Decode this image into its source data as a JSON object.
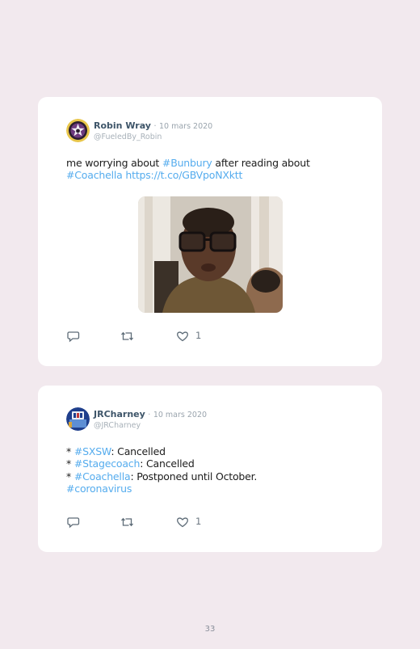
{
  "tweets": [
    {
      "author": "Robin Wray",
      "separator": "·",
      "date": "10 mars 2020",
      "handle": "@FueledBy_Robin",
      "lines": [
        [
          {
            "text": "me worrying about ",
            "tag": false
          },
          {
            "text": "#Bunbury",
            "tag": true
          },
          {
            "text": " after reading about",
            "tag": false
          }
        ],
        [
          {
            "text": "#Coachella",
            "tag": true
          },
          {
            "text": " ",
            "tag": false
          },
          {
            "text": "https://t.co/GBVpoNXktt",
            "tag": true
          }
        ]
      ],
      "likes": "1",
      "has_media": true,
      "avatar_icon": "purple-star-badge-avatar",
      "media_icon": "man-with-glasses-gif"
    },
    {
      "author": "JRCharney",
      "separator": "·",
      "date": "10 mars 2020",
      "handle": "@JRCharney",
      "lines": [
        [
          {
            "text": "* ",
            "tag": false
          },
          {
            "text": "#SXSW",
            "tag": true
          },
          {
            "text": ": Cancelled",
            "tag": false
          }
        ],
        [
          {
            "text": "* ",
            "tag": false
          },
          {
            "text": "#Stagecoach",
            "tag": true
          },
          {
            "text": ": Cancelled",
            "tag": false
          }
        ],
        [
          {
            "text": "* ",
            "tag": false
          },
          {
            "text": "#Coachella",
            "tag": true
          },
          {
            "text": ": Postponed until October.",
            "tag": false
          }
        ],
        [
          {
            "text": "#coronavirus",
            "tag": true
          }
        ]
      ],
      "likes": "1",
      "has_media": false,
      "avatar_icon": "station-logo-avatar"
    }
  ],
  "page": {
    "number": "33"
  },
  "colors": {
    "background": "#f2e9ee",
    "card": "#ffffff",
    "hashtag": "#55acee",
    "author": "#3e5569"
  }
}
